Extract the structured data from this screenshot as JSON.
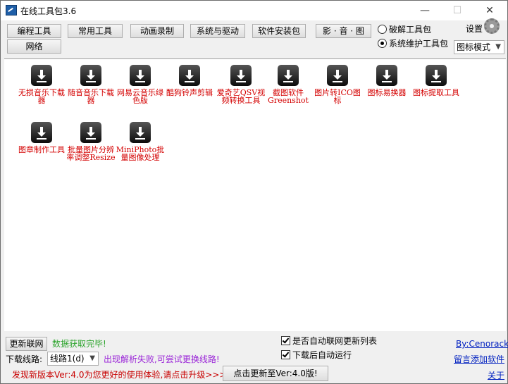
{
  "window": {
    "title": "在线工具包3.6",
    "minimize": "—",
    "maximize": "☐",
    "close": "✕"
  },
  "toolbar": {
    "buttons": [
      "编程工具",
      "常用工具",
      "动画录制",
      "系统与驱动",
      "软件安装包",
      "影 · 音 · 图",
      "网络"
    ],
    "radios": [
      {
        "label": "破解工具包",
        "checked": false
      },
      {
        "label": "系统维护工具包",
        "checked": true
      }
    ],
    "settings_label": "设置",
    "view_mode": "图标模式"
  },
  "tools": [
    "无损音乐下载器",
    "随音音乐下载器",
    "网易云音乐绿色版",
    "酷狗铃声剪辑",
    "爱奇艺QSV视频转换工具",
    "截图软件Greenshot",
    "图片转ICO图标",
    "图标易换器",
    "图标提取工具",
    "图章制作工具",
    "批量图片分辨率调整Resize",
    "MiniPhoto批量图像处理"
  ],
  "bottom": {
    "refresh_button": "更新联网",
    "data_status": "数据获取完毕!",
    "download_route_label": "下载线路:",
    "route_value": "线路1(d)",
    "route_hint": "出现解析失败,可尝试更换线路!",
    "auto_refresh_label": "是否自动联网更新列表",
    "auto_run_label": "下载后自动运行",
    "author_link": "By:Cenorack",
    "add_software_link": "留言添加软件",
    "new_version_text": "发现新版本Ver:4.0为您更好的使用体验,请点击升级>>>",
    "update_button": "点击更新至Ver:4.0版!",
    "about_link": "关于"
  }
}
